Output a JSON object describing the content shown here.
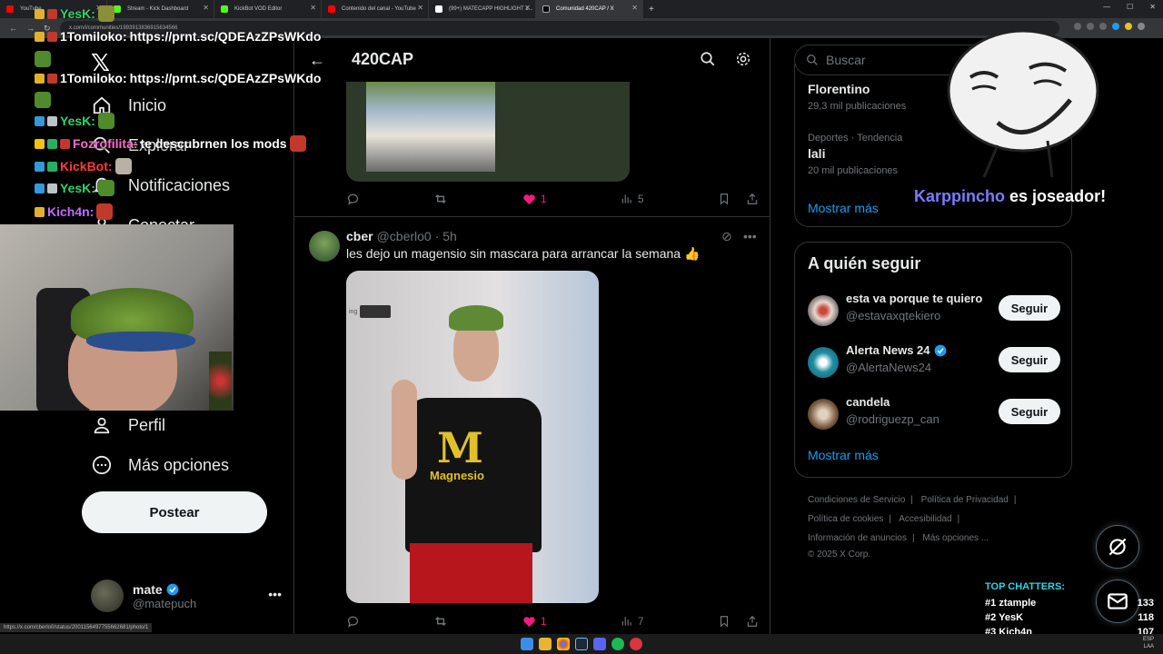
{
  "browser": {
    "tabs": [
      {
        "label": "YouTube",
        "color": "#ff0000"
      },
      {
        "label": "Stream - Kick Dashboard",
        "color": "#53fc18"
      },
      {
        "label": "KickBot VOD Editor",
        "color": "#53fc18"
      },
      {
        "label": "Contenido del canal - YouTube",
        "color": "#ff0000"
      },
      {
        "label": "(99+) MATECAPP HIGHLIGHT 1...",
        "color": "#ffffff"
      },
      {
        "label": "Comunidad 420CAP / X",
        "color": "#ffffff"
      }
    ],
    "url": "x.com/i/communities/1993913836915634566",
    "status_url": "https://x.com/cberlo0/status/2001156497755662681/photo/1"
  },
  "nav": {
    "items": [
      {
        "label": "Inicio",
        "icon": "home-icon"
      },
      {
        "label": "Explorar",
        "icon": "search-icon"
      },
      {
        "label": "Notificaciones",
        "icon": "bell-icon"
      },
      {
        "label": "Conectar",
        "icon": "connect-icon"
      },
      {
        "label": "Perfil",
        "icon": "person-icon"
      },
      {
        "label": "Más opciones",
        "icon": "more-circle-icon"
      }
    ],
    "post_button": "Postear",
    "profile": {
      "name": "mate",
      "handle": "@matepuch"
    }
  },
  "chat": [
    {
      "user": "YesK:",
      "color": "#32d36a",
      "text": ""
    },
    {
      "user": "1Tomiloko:",
      "color": "#ffffff",
      "text": "https://prnt.sc/QDEAzZPsWKdo"
    },
    {
      "user": "1Tomiloko:",
      "color": "#ffffff",
      "text": "https://prnt.sc/QDEAzZPsWKdo"
    },
    {
      "user": "YesK:",
      "color": "#32d36a",
      "text": ""
    },
    {
      "user": "Fozrofilita:",
      "color": "#ff6bcb",
      "text": "te descubrnen los mods"
    },
    {
      "user": "KickBot:",
      "color": "#ff3b3b",
      "text": ""
    },
    {
      "user": "YesK:",
      "color": "#32d36a",
      "text": ""
    },
    {
      "user": "Kich4n:",
      "color": "#c06bff",
      "text": ""
    }
  ],
  "community": {
    "title": "420CAP"
  },
  "post_prev": {
    "likes": "1",
    "views": "5"
  },
  "post": {
    "name": "cber",
    "handle": "@cberlo0",
    "time": "· 5h",
    "text": "les dejo un magensio sin mascara para arrancar la semana 👍",
    "shirt_text": "Magnesio",
    "likes": "1",
    "views": "7"
  },
  "right": {
    "search_placeholder": "Buscar",
    "trends": [
      {
        "category": "",
        "name": "Florentino",
        "count": "29,3 mil publicaciones"
      },
      {
        "category": "Deportes · Tendencia",
        "name": "lali",
        "count": "20 mil publicaciones"
      }
    ],
    "show_more": "Mostrar más",
    "follow_title": "A quién seguir",
    "follow": [
      {
        "name": "esta va porque te quiero",
        "handle": "@estavaxqtekiero",
        "verified": false,
        "avatar": "#d8c6c0"
      },
      {
        "name": "Alerta News 24",
        "handle": "@AlertaNews24",
        "verified": true,
        "avatar": "#1f8ea3"
      },
      {
        "name": "candela",
        "handle": "@rodriguezp_can",
        "verified": false,
        "avatar": "#a0836a"
      }
    ],
    "follow_button": "Seguir",
    "footer": [
      "Condiciones de Servicio",
      "Política de Privacidad",
      "Política de cookies",
      "Accesibilidad",
      "Información de anuncios",
      "Más opciones ...",
      "© 2025 X Corp."
    ]
  },
  "overlay": {
    "meme_name": "Karppincho",
    "meme_text": "es joseador!",
    "top_chatters_title": "TOP CHATTERS:",
    "top_chatters": [
      {
        "rank": "#1",
        "name": "ztample",
        "count": "133"
      },
      {
        "rank": "#2",
        "name": "YesK",
        "count": "118"
      },
      {
        "rank": "#3",
        "name": "Kich4n",
        "count": "107"
      }
    ]
  },
  "taskbar": {
    "lang": "ESP",
    "region": "LAA"
  }
}
